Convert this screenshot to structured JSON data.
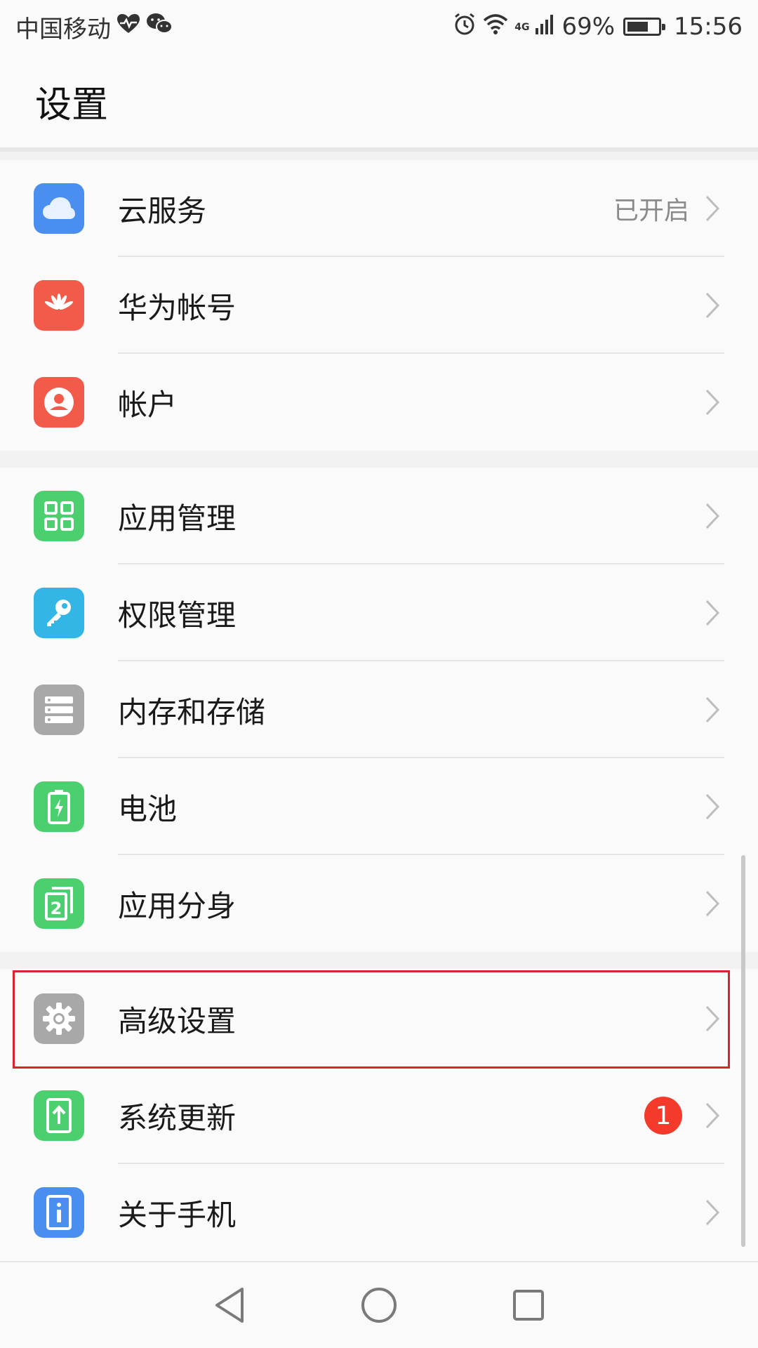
{
  "status_bar": {
    "carrier": "中国移动",
    "battery_percent": "69%",
    "time": "15:56",
    "network": "4G",
    "battery_level": 0.69
  },
  "header": {
    "title": "设置"
  },
  "groups": [
    {
      "items": [
        {
          "label": "云服务",
          "value": "已开启",
          "icon": "cloud-icon",
          "color": "#4a8ef0"
        },
        {
          "label": "华为帐号",
          "icon": "huawei-logo-icon",
          "color": "#f25a4a"
        },
        {
          "label": "帐户",
          "icon": "user-icon",
          "color": "#f25a4a"
        }
      ]
    },
    {
      "items": [
        {
          "label": "应用管理",
          "icon": "apps-grid-icon",
          "color": "#4ccf6f"
        },
        {
          "label": "权限管理",
          "icon": "key-icon",
          "color": "#33b6e6"
        },
        {
          "label": "内存和存储",
          "icon": "storage-icon",
          "color": "#a8a8a8"
        },
        {
          "label": "电池",
          "icon": "battery-icon",
          "color": "#4ccf6f"
        },
        {
          "label": "应用分身",
          "icon": "app-twin-icon",
          "color": "#4ccf6f"
        }
      ]
    },
    {
      "items": [
        {
          "label": "高级设置",
          "icon": "gear-icon",
          "color": "#a8a8a8"
        },
        {
          "label": "系统更新",
          "icon": "system-update-icon",
          "color": "#4ccf6f",
          "badge": "1"
        },
        {
          "label": "关于手机",
          "icon": "info-icon",
          "color": "#4a8ef0"
        }
      ]
    }
  ]
}
